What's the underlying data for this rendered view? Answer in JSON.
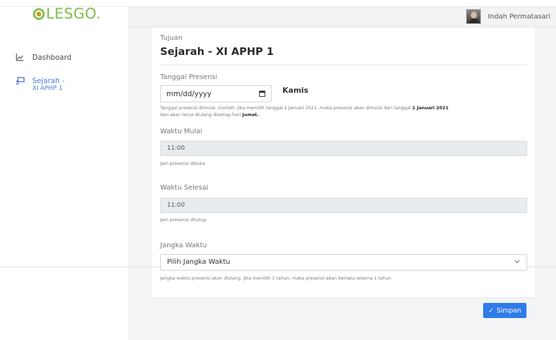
{
  "brand": {
    "text": "LESGO",
    "dot": "."
  },
  "user": {
    "name": "Indah Permatasari"
  },
  "sidebar": {
    "items": [
      {
        "label": "Dashboard",
        "icon": "chart-line-icon"
      },
      {
        "label": "Sejarah -",
        "label2": "XI APHP 1",
        "icon": "presentation-icon"
      }
    ]
  },
  "form": {
    "tujuan_label": "Tujuan",
    "tujuan_value": "Sejarah - XI APHP 1",
    "tanggal_label": "Tanggal Presensi",
    "tanggal_placeholder": "mm/dd/yyyy",
    "day_name": "Kamis",
    "tanggal_help_1a": "Tanggal presensi dimulai. Contoh: jika memilih tanggal 1 Januari 2021, maka presensi akan dimulai dari tanggal ",
    "tanggal_help_1b": "1 Januari 2021",
    "tanggal_help_2a": "dan akan terus diulang disetiap hari ",
    "tanggal_help_2b": "Jumat.",
    "waktu_mulai_label": "Waktu Mulai",
    "waktu_mulai_value": "11:00",
    "waktu_mulai_help": "Jam presensi dibuka",
    "waktu_selesai_label": "Waktu Selesai",
    "waktu_selesai_value": "11:00",
    "waktu_selesai_help": "Jam presensi ditutup",
    "jangka_label": "Jangka Waktu",
    "jangka_value": "Pilih Jangka Waktu",
    "jangka_help": "Jangka waktu presensi akan diulang. Jika memilih 1 tahun, maka presensi akan berlaku selama 1 tahun"
  },
  "footer": {
    "save_label": "Simpan",
    "save_icon": "check-icon"
  },
  "colors": {
    "brand": "#7cc14a",
    "primary": "#2f7bea",
    "active_nav": "#4b7bd4"
  }
}
